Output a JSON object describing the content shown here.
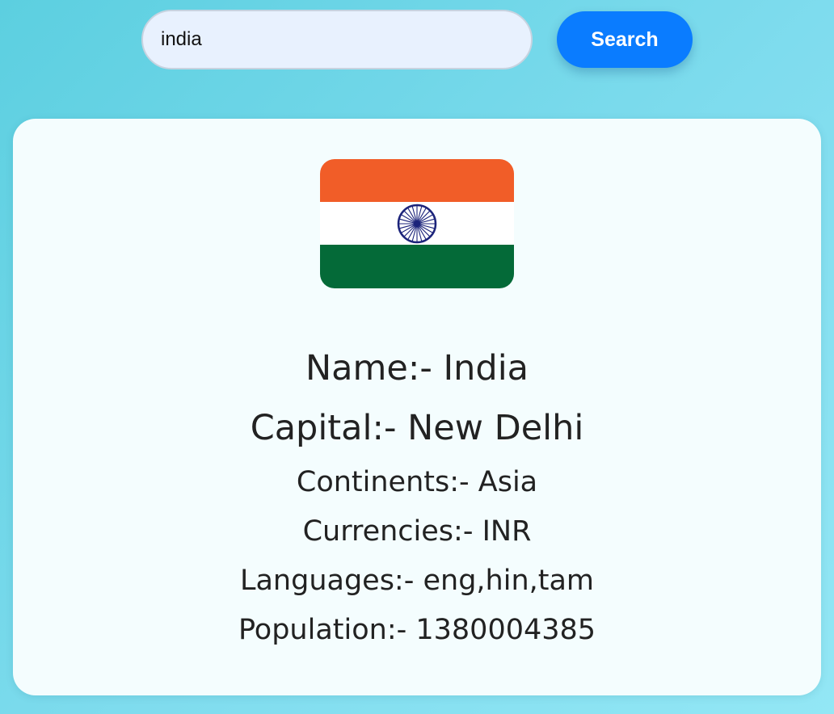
{
  "search": {
    "value": "india",
    "button_label": "Search"
  },
  "country": {
    "flag_icon": "india-flag-icon",
    "flag_colors": {
      "saffron": "#f15d28",
      "white": "#ffffff",
      "green": "#046a38",
      "chakra": "#1b237a"
    },
    "name": "Name:- India",
    "capital": "Capital:- New Delhi",
    "continents": "Continents:- Asia",
    "currencies": "Currencies:- INR",
    "languages": "Languages:- eng,hin,tam",
    "population": "Population:- 1380004385"
  },
  "colors": {
    "accent": "#0a7cff",
    "card_background": "#f4fdfe",
    "page_background": "#7fdcee"
  }
}
